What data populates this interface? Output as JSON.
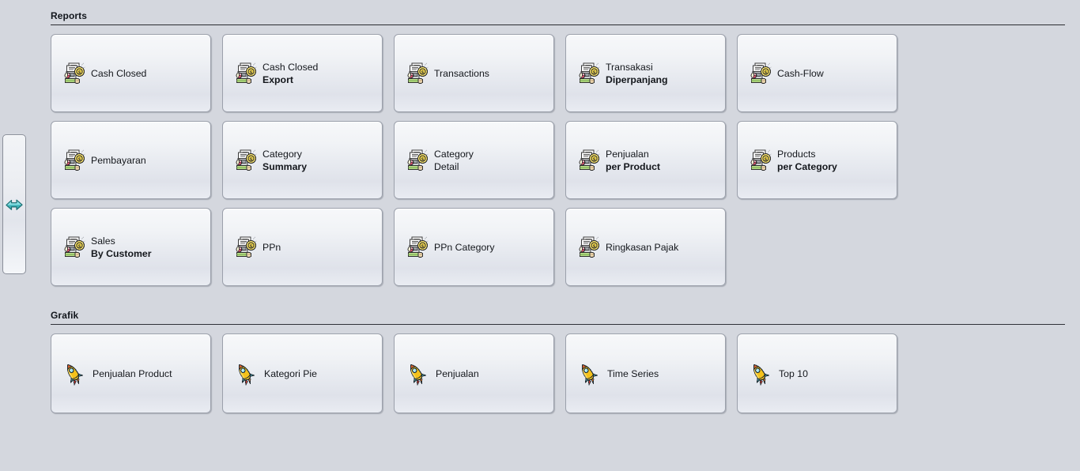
{
  "colors": {
    "background": "#d4d7de",
    "card_border": "#9ba0ab",
    "rule": "#2a2c31",
    "text": "#14171c",
    "arrow_teal": "#4fc4c8",
    "rocket_yellow": "#f5c21b"
  },
  "splitter": {
    "icon": "double-arrow-right-icon",
    "tooltip": ""
  },
  "sections": [
    {
      "id": "reports",
      "title": "Reports",
      "cards": [
        {
          "icon": "report-money-icon",
          "line1": "Cash Closed",
          "line2": "",
          "line2_bold": false
        },
        {
          "icon": "report-money-icon",
          "line1": "Cash Closed",
          "line2": "Export",
          "line2_bold": true
        },
        {
          "icon": "report-money-icon",
          "line1": "Transactions",
          "line2": "",
          "line2_bold": false
        },
        {
          "icon": "report-money-icon",
          "line1": "Transakasi",
          "line2": "Diperpanjang",
          "line2_bold": true
        },
        {
          "icon": "report-money-icon",
          "line1": "Cash-Flow",
          "line2": "",
          "line2_bold": false
        },
        {
          "icon": "report-money-icon",
          "line1": "Pembayaran",
          "line2": "",
          "line2_bold": false
        },
        {
          "icon": "report-money-icon",
          "line1": "Category",
          "line2": "Summary",
          "line2_bold": true
        },
        {
          "icon": "report-money-icon",
          "line1": "Category",
          "line2": "Detail",
          "line2_bold": false
        },
        {
          "icon": "report-money-icon",
          "line1": "Penjualan",
          "line2": "per Product",
          "line2_bold": true
        },
        {
          "icon": "report-money-icon",
          "line1": "Products",
          "line2": "per Category",
          "line2_bold": true
        },
        {
          "icon": "report-money-icon",
          "line1": "Sales",
          "line2": "By Customer",
          "line2_bold": true
        },
        {
          "icon": "report-money-icon",
          "line1": "PPn",
          "line2": "",
          "line2_bold": false
        },
        {
          "icon": "report-money-icon",
          "line1": "PPn Category",
          "line2": "",
          "line2_bold": false
        },
        {
          "icon": "report-money-icon",
          "line1": "Ringkasan Pajak",
          "line2": "",
          "line2_bold": false
        }
      ]
    },
    {
      "id": "grafik",
      "title": "Grafik",
      "cards": [
        {
          "icon": "rocket-icon",
          "line1": "Penjualan Product",
          "line2": "",
          "line2_bold": false
        },
        {
          "icon": "rocket-icon",
          "line1": "Kategori Pie",
          "line2": "",
          "line2_bold": false
        },
        {
          "icon": "rocket-icon",
          "line1": "Penjualan",
          "line2": "",
          "line2_bold": false
        },
        {
          "icon": "rocket-icon",
          "line1": "Time Series",
          "line2": "",
          "line2_bold": false
        },
        {
          "icon": "rocket-icon",
          "line1": "Top 10",
          "line2": "",
          "line2_bold": false
        }
      ]
    }
  ]
}
